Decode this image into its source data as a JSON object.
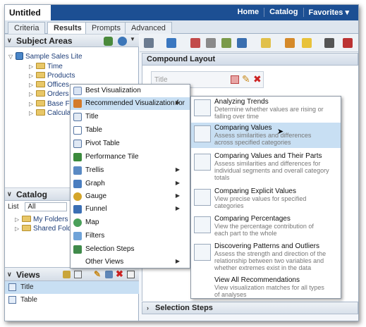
{
  "app": {
    "title": "Untitled",
    "topnav": [
      "Home",
      "Catalog",
      "Favorites ▾"
    ]
  },
  "editor_tabs": [
    {
      "label": "Criteria",
      "active": false
    },
    {
      "label": "Results",
      "active": true
    },
    {
      "label": "Prompts",
      "active": false
    },
    {
      "label": "Advanced",
      "active": false
    }
  ],
  "subject_areas": {
    "header": "Subject Areas",
    "root": "Sample Sales Lite",
    "items": [
      "Time",
      "Products",
      "Offices",
      "Orders",
      "Base F",
      "Calcula"
    ]
  },
  "catalog": {
    "header": "Catalog",
    "list_label": "List",
    "list_value": "All",
    "items": [
      "My Folders",
      "Shared Folde"
    ]
  },
  "views": {
    "header": "Views",
    "items": [
      {
        "label": "Title",
        "selected": true
      },
      {
        "label": "Table",
        "selected": false
      }
    ]
  },
  "compound_layout": {
    "header": "Compound Layout",
    "view_title": "Title"
  },
  "selection_steps": {
    "header": "Selection Steps"
  },
  "context_menu": {
    "items": [
      {
        "label": "Best Visualization",
        "has_sub": false,
        "icon": "best-visualization-icon"
      },
      {
        "label": "Recommended Visualization for",
        "has_sub": true,
        "icon": "recommended-visualization-icon",
        "highlighted": true
      },
      {
        "label": "Title",
        "has_sub": false,
        "icon": "title-icon"
      },
      {
        "label": "Table",
        "has_sub": false,
        "icon": "table-icon"
      },
      {
        "label": "Pivot Table",
        "has_sub": false,
        "icon": "pivot-table-icon"
      },
      {
        "label": "Performance Tile",
        "has_sub": false,
        "icon": "performance-tile-icon"
      },
      {
        "label": "Trellis",
        "has_sub": true,
        "icon": "trellis-icon"
      },
      {
        "label": "Graph",
        "has_sub": true,
        "icon": "graph-icon"
      },
      {
        "label": "Gauge",
        "has_sub": true,
        "icon": "gauge-icon"
      },
      {
        "label": "Funnel",
        "has_sub": true,
        "icon": "funnel-icon"
      },
      {
        "label": "Map",
        "has_sub": false,
        "icon": "map-icon"
      },
      {
        "label": "Filters",
        "has_sub": false,
        "icon": "filters-icon"
      },
      {
        "label": "Selection Steps",
        "has_sub": false,
        "icon": "selection-steps-icon"
      },
      {
        "label": "Other Views",
        "has_sub": true,
        "icon": ""
      }
    ]
  },
  "submenu": {
    "items": [
      {
        "title": "Analyzing Trends",
        "desc": [
          "Determine whether values are rising or",
          "falling over time"
        ],
        "icon": "trends-icon"
      },
      {
        "title": "Comparing Values",
        "desc": [
          "Assess similarities and differences",
          "across specified categories"
        ],
        "icon": "compare-values-icon",
        "highlighted": true
      },
      {
        "title": "Comparing Values and Their Parts",
        "desc": [
          "Assess similarities and differences for",
          "individual segments and overall category",
          "totals"
        ],
        "icon": "compare-parts-icon"
      },
      {
        "title": "Comparing Explicit Values",
        "desc": [
          "View precise values for specified",
          "categories"
        ],
        "icon": "explicit-values-icon"
      },
      {
        "title": "Comparing Percentages",
        "desc": [
          "View the percentage contribution of",
          "each part to the whole"
        ],
        "icon": "percentages-icon"
      },
      {
        "title": "Discovering Patterns and Outliers",
        "desc": [
          "Assess the strength and direction of the",
          "relationship between two variables and",
          "whether extremes exist in the data"
        ],
        "icon": "patterns-icon"
      },
      {
        "title": "View All Recommendations",
        "desc": [
          "View visualization matches for all types",
          "of analyses"
        ],
        "icon": ""
      }
    ]
  },
  "colors": {
    "brand_bar": "#1c4f93",
    "highlight": "#c8dff3",
    "delete_red": "#cc2222"
  }
}
